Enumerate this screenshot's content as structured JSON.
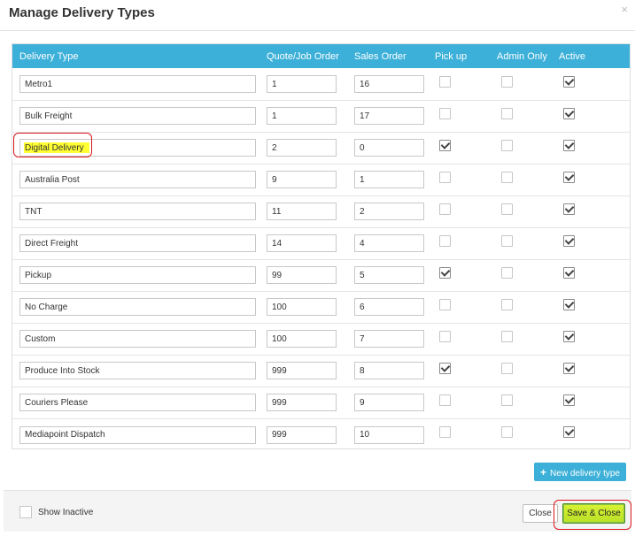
{
  "dialog": {
    "title": "Manage Delivery Types",
    "close_glyph": "×"
  },
  "table": {
    "headers": [
      "Delivery Type",
      "Quote/Job Order",
      "Sales Order",
      "Pick up",
      "Admin Only",
      "Active"
    ],
    "rows": [
      {
        "name": "Metro1",
        "quote_order": "1",
        "sales_order": "16",
        "pickup": false,
        "admin_only": false,
        "active": true
      },
      {
        "name": "Bulk Freight",
        "quote_order": "1",
        "sales_order": "17",
        "pickup": false,
        "admin_only": false,
        "active": true
      },
      {
        "name": "Digital Delivery",
        "quote_order": "2",
        "sales_order": "0",
        "pickup": true,
        "admin_only": false,
        "active": true,
        "highlighted": true
      },
      {
        "name": "Australia Post",
        "quote_order": "9",
        "sales_order": "1",
        "pickup": false,
        "admin_only": false,
        "active": true
      },
      {
        "name": "TNT",
        "quote_order": "11",
        "sales_order": "2",
        "pickup": false,
        "admin_only": false,
        "active": true
      },
      {
        "name": "Direct Freight",
        "quote_order": "14",
        "sales_order": "4",
        "pickup": false,
        "admin_only": false,
        "active": true
      },
      {
        "name": "Pickup",
        "quote_order": "99",
        "sales_order": "5",
        "pickup": true,
        "admin_only": false,
        "active": true
      },
      {
        "name": "No Charge",
        "quote_order": "100",
        "sales_order": "6",
        "pickup": false,
        "admin_only": false,
        "active": true
      },
      {
        "name": "Custom",
        "quote_order": "100",
        "sales_order": "7",
        "pickup": false,
        "admin_only": false,
        "active": true
      },
      {
        "name": "Produce Into Stock",
        "quote_order": "999",
        "sales_order": "8",
        "pickup": true,
        "admin_only": false,
        "active": true
      },
      {
        "name": "Couriers Please",
        "quote_order": "999",
        "sales_order": "9",
        "pickup": false,
        "admin_only": false,
        "active": true
      },
      {
        "name": "Mediapoint Dispatch",
        "quote_order": "999",
        "sales_order": "10",
        "pickup": false,
        "admin_only": false,
        "active": true
      }
    ]
  },
  "new_button": {
    "icon": "plus-icon",
    "label": "New delivery type",
    "plus_glyph": "+"
  },
  "footer": {
    "show_inactive_label": "Show Inactive",
    "show_inactive_checked": false,
    "close_label": "Close",
    "save_label": "Save & Close"
  },
  "colors": {
    "header_bg": "#3cb0d8",
    "highlight_ring": "#d9161e",
    "highlight_text_bg": "#ffff33",
    "save_button": "#c8e82e"
  }
}
